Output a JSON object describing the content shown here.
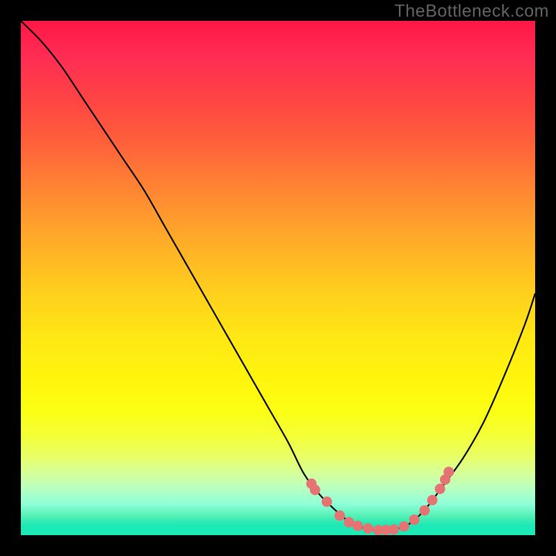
{
  "watermark": "TheBottleneck.com",
  "chart_data": {
    "type": "line",
    "title": "",
    "xlabel": "",
    "ylabel": "",
    "xlim": [
      0,
      100
    ],
    "ylim": [
      0,
      100
    ],
    "grid": false,
    "series": [
      {
        "name": "bottleneck-curve",
        "x": [
          0,
          4,
          8,
          12,
          16,
          20,
          24,
          28,
          32,
          36,
          40,
          44,
          48,
          52,
          55,
          58,
          61,
          64,
          67,
          70,
          73,
          76,
          79,
          82,
          86,
          90,
          94,
          98,
          100
        ],
        "y": [
          100,
          96,
          91,
          85,
          79,
          73,
          67,
          60,
          53,
          46,
          39,
          32,
          25,
          18,
          12,
          8,
          5,
          2.5,
          1.3,
          1.0,
          1.2,
          2.5,
          5.5,
          9.5,
          15,
          22,
          31,
          41,
          47
        ]
      }
    ],
    "marker_points": {
      "name": "highlight-dots",
      "x": [
        56.5,
        57.2,
        59.5,
        62.0,
        63.8,
        65.5,
        67.5,
        69.5,
        71.0,
        72.5,
        74.5,
        76.5,
        78.5,
        80.0,
        81.5,
        82.5,
        83.2
      ],
      "y": [
        10.0,
        8.8,
        6.5,
        3.8,
        2.5,
        1.8,
        1.3,
        1.0,
        1.0,
        1.1,
        1.7,
        3.0,
        4.8,
        6.8,
        9.0,
        10.8,
        12.3
      ]
    },
    "colors": {
      "curve": "#000000",
      "markers": "#e57373",
      "background_top": "#ff1744",
      "background_bottom": "#1de9b6"
    }
  }
}
